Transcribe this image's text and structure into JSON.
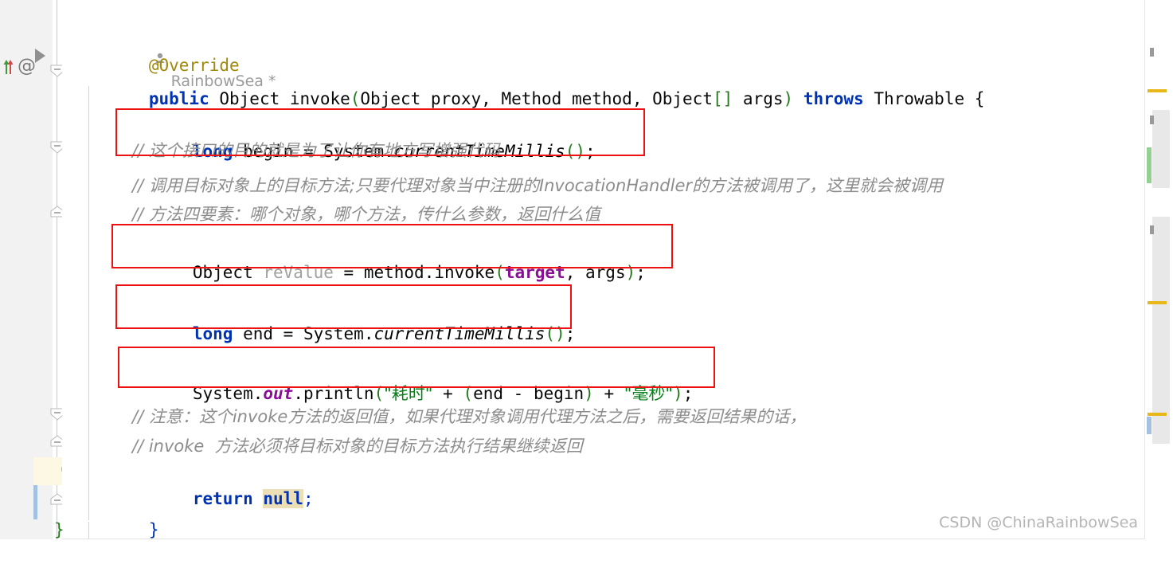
{
  "editor": {
    "author_inlay": "RainbowSea *",
    "author_icon": "user-icon",
    "watermark": "CSDN @ChinaRainbowSea",
    "lines": [
      {
        "id": "annotation",
        "text": "@Override"
      },
      {
        "id": "signature",
        "segments": [
          "public",
          " Object invoke",
          "(",
          "Object proxy, Method method, Object",
          "[]",
          " args",
          ")",
          " throws",
          " Throwable {"
        ]
      },
      {
        "id": "long-begin",
        "text": "long begin = System.currentTimeMillis();"
      },
      {
        "id": "comment-1",
        "text": "// 这个接口的目的就是为了让你有地方写增强代码"
      },
      {
        "id": "comment-2",
        "text": "// 调用目标对象上的目标方法;只要代理对象当中注册的InvocationHandler的方法被调用了，这里就会被调用"
      },
      {
        "id": "comment-3",
        "text": "// 方法四要素：哪个对象，哪个方法，传什么参数，返回什么值"
      },
      {
        "id": "object-revalue",
        "text": "Object reValue = method.invoke(target, args);"
      },
      {
        "id": "long-end",
        "text": "long end = System.currentTimeMillis();"
      },
      {
        "id": "println",
        "text": "System.out.println(\"耗时\" + (end - begin) + \"毫秒\");"
      },
      {
        "id": "comment-4",
        "text": "// 注意：这个invoke方法的返回值，如果代理对象调用代理方法之后，需要返回结果的话，"
      },
      {
        "id": "comment-5",
        "text": "// invoke  方法必须将目标对象的目标方法执行结果继续返回"
      },
      {
        "id": "return-null",
        "text": "return null;"
      },
      {
        "id": "closing-brace",
        "text": "}"
      }
    ],
    "tokens": {
      "kw_public": "public",
      "kw_throws": "throws",
      "kw_long": "long",
      "kw_return": "return",
      "kw_null": "null",
      "type_object": "Object",
      "type_throwable": "Throwable",
      "type_method": "Method",
      "type_system": "System",
      "method_invoke": "invoke",
      "method_currentTimeMillis": "currentTimeMillis",
      "method_println": "println",
      "var_begin": "begin",
      "var_end": "end",
      "var_proxy": "proxy",
      "var_method": "method",
      "var_args": "args",
      "var_target": "target",
      "var_revalue": "reValue",
      "field_out": "out",
      "str_haoshi": "\"耗时\"",
      "str_haomiao": "\"毫秒\"",
      "annotation_override": "@Override",
      "brace_open": "{",
      "brace_close": "}",
      "semicolon": ";",
      "plus": "+",
      "minus": "-",
      "equals": "="
    },
    "gutter": {
      "implements_icon": "implements-arrow-icon",
      "annotation_icon": "at-annotation-icon",
      "run_icon": "run-play-icon",
      "bulb_icon": "intention-bulb-icon",
      "fold_icon": "code-fold-marker-icon"
    },
    "scrollbar": {
      "warning_marker": "warning-stripe",
      "vcs_marker": "vcs-change-stripe",
      "thumb": "scrollbar-thumb"
    },
    "colors": {
      "keyword": "#0033b3",
      "string": "#067d17",
      "comment": "#8c8c8c",
      "annotation": "#9e880d",
      "field": "#871094",
      "paren": "#267a1e",
      "unused": "#a0a0a0",
      "redbox": "#ee1111",
      "caret_line": "#fdf8e3",
      "gutter_bg": "#f2f2f2"
    }
  }
}
